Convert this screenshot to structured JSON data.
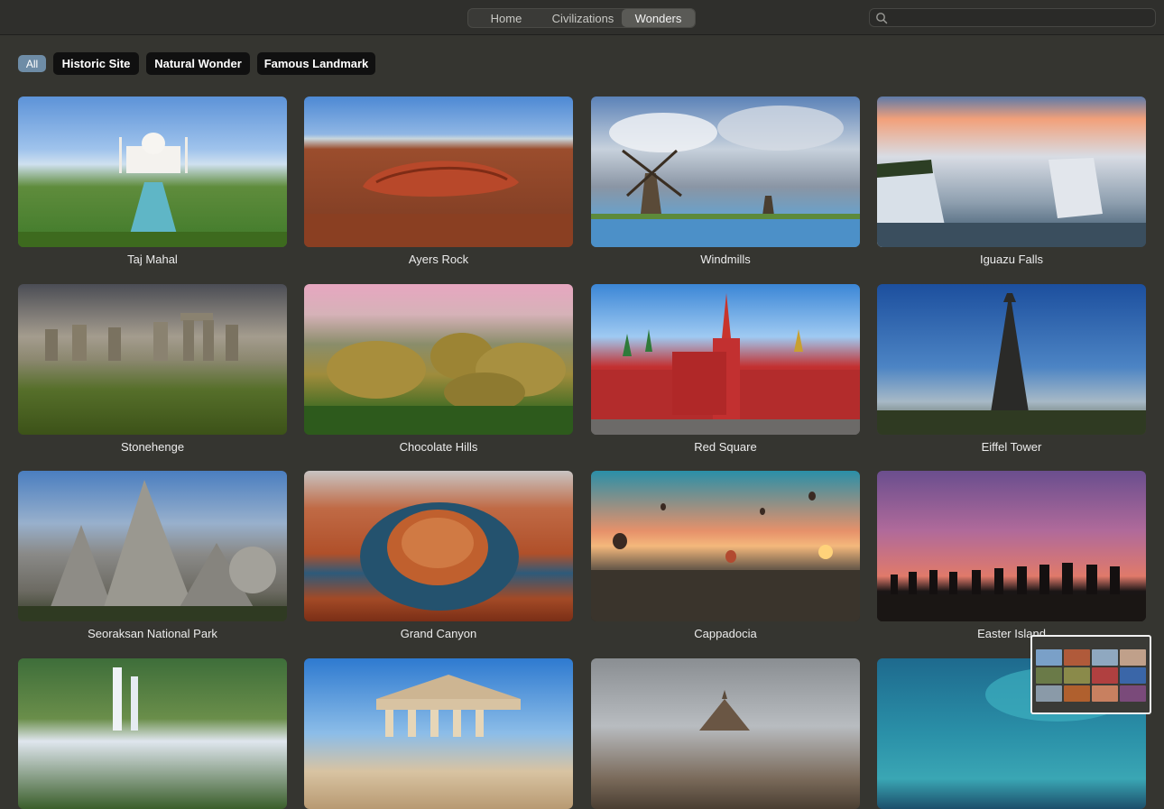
{
  "toolbar": {
    "tabs": [
      {
        "label": "Home"
      },
      {
        "label": "Civilizations"
      },
      {
        "label": "Wonders",
        "selected": true
      }
    ],
    "search": {
      "value": "",
      "placeholder": ""
    }
  },
  "filters": [
    {
      "label": "All",
      "selected": true
    },
    {
      "label": "Historic Site"
    },
    {
      "label": "Natural Wonder"
    },
    {
      "label": "Famous Landmark"
    }
  ],
  "wonders": [
    {
      "name": "Taj Mahal"
    },
    {
      "name": "Ayers Rock"
    },
    {
      "name": "Windmills"
    },
    {
      "name": "Iguazu Falls"
    },
    {
      "name": "Stonehenge"
    },
    {
      "name": "Chocolate Hills"
    },
    {
      "name": "Red Square"
    },
    {
      "name": "Eiffel Tower"
    },
    {
      "name": "Seoraksan National Park"
    },
    {
      "name": "Grand Canyon"
    },
    {
      "name": "Cappadocia"
    },
    {
      "name": "Easter Island"
    }
  ],
  "colors": {
    "background": "#353530",
    "accent_all_chip": "#6e8ca6",
    "chip_background": "#101010"
  }
}
